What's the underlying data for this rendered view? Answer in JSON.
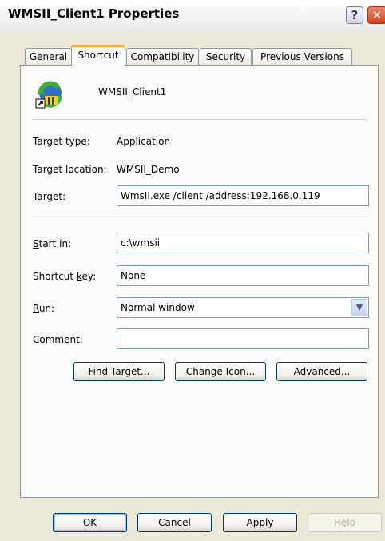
{
  "window": {
    "title": "WMSII_Client1 Properties"
  },
  "titlebar": {
    "help_label": "?",
    "close_label": "✕"
  },
  "tabs": [
    {
      "label": "General"
    },
    {
      "label": "Shortcut"
    },
    {
      "label": "Compatibility"
    },
    {
      "label": "Security"
    },
    {
      "label": "Previous Versions"
    }
  ],
  "active_tab": "Shortcut",
  "shortcut": {
    "name": "WMSII_Client1",
    "target_type_label": "Target type:",
    "target_type_value": "Application",
    "target_location_label": "Target location:",
    "target_location_value": "WMSII_Demo",
    "target_label": {
      "pre": "",
      "key": "T",
      "post": "arget:"
    },
    "target_value": "WmsII.exe /client /address:192.168.0.119",
    "start_in_label": {
      "pre": "",
      "key": "S",
      "post": "tart in:"
    },
    "start_in_value": "c:\\wmsii",
    "shortcut_key_label": {
      "pre": "Shortcut ",
      "key": "k",
      "post": "ey:"
    },
    "shortcut_key_value": "None",
    "run_label": {
      "pre": "",
      "key": "R",
      "post": "un:"
    },
    "run_value": "Normal window",
    "comment_label": {
      "pre": "C",
      "key": "o",
      "post": "mment:"
    },
    "comment_value": ""
  },
  "actions": {
    "find_target": {
      "pre": "",
      "key": "F",
      "post": "ind Target..."
    },
    "change_icon": {
      "pre": "",
      "key": "C",
      "post": "hange Icon..."
    },
    "advanced": {
      "pre": "A",
      "key": "d",
      "post": "vanced..."
    }
  },
  "dialog_buttons": {
    "ok": "OK",
    "cancel": "Cancel",
    "apply": {
      "pre": "",
      "key": "A",
      "post": "pply"
    },
    "help": "Help"
  },
  "colors": {
    "tab_highlight": "#f3a13a",
    "dialog_bg": "#ece9d8",
    "field_border": "#7f9db9"
  }
}
